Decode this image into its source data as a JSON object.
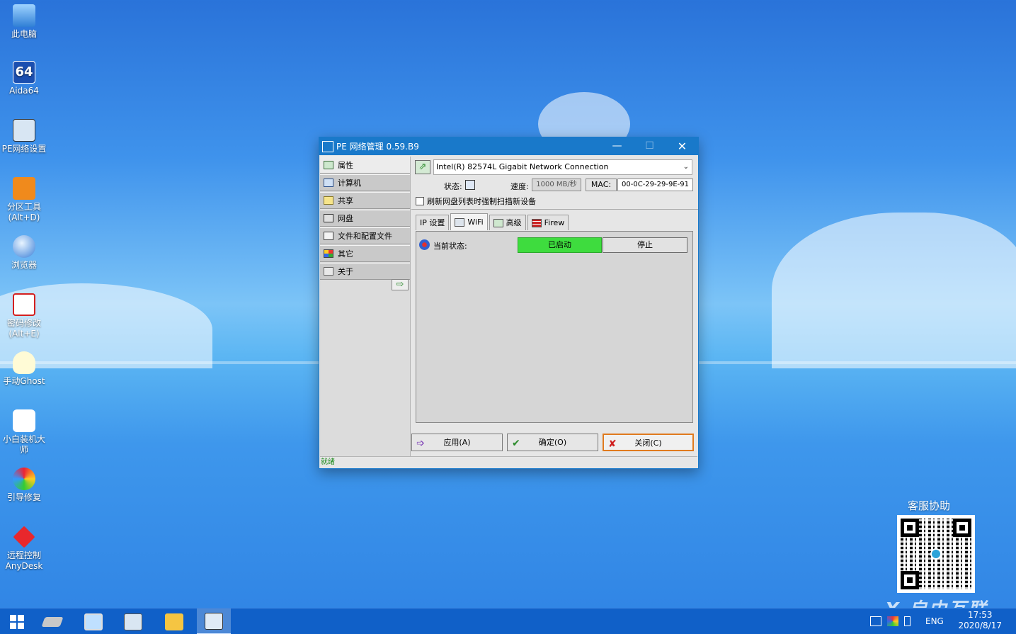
{
  "desktop": {
    "icons": [
      {
        "label": "此电脑"
      },
      {
        "label": "Aida64"
      },
      {
        "label": "PE网络设置"
      },
      {
        "label": "分区工具\n(Alt+D)"
      },
      {
        "label": "浏览器"
      },
      {
        "label": "密码修改\n(Alt+E)"
      },
      {
        "label": "手动Ghost"
      },
      {
        "label": "小白装机大\n师"
      },
      {
        "label": "引导修复"
      },
      {
        "label": "远程控制\nAnyDesk"
      }
    ],
    "qr_title": "客服协助",
    "watermark": "X 自由互联"
  },
  "window": {
    "title": "PE 网络管理 0.59.B9",
    "controls": {
      "minimize": "—",
      "maximize": "☐",
      "close": "✕"
    },
    "sidebar": [
      {
        "label": "属性",
        "active": true
      },
      {
        "label": "计算机"
      },
      {
        "label": "共享"
      },
      {
        "label": "网盘"
      },
      {
        "label": "文件和配置文件"
      },
      {
        "label": "其它"
      },
      {
        "label": "关于"
      }
    ],
    "adapter": "Intel(R) 82574L Gigabit Network Connection",
    "status_label": "状态:",
    "speed_label": "速度:",
    "speed_value": "1000 MB/秒",
    "mac_label": "MAC:",
    "mac_value": "00-0C-29-29-9E-91",
    "refresh_label": "刷新网盘列表时强制扫描新设备",
    "tabs": [
      {
        "label": "IP 设置"
      },
      {
        "label": "WiFi",
        "active": true
      },
      {
        "label": "高级"
      },
      {
        "label": "Firew"
      }
    ],
    "wifi": {
      "current_state_label": "当前状态:",
      "state_value": "已启动",
      "stop_label": "停止"
    },
    "buttons": {
      "apply": "应用(A)",
      "ok": "确定(O)",
      "close": "关闭(C)"
    },
    "statusbar": "就绪"
  },
  "taskbar": {
    "lang": "ENG",
    "time": "17:53",
    "date": "2020/8/17"
  },
  "colors": {
    "titlebar": "#1979ca",
    "state_green": "#3edc3e",
    "taskbar": "#1060c8"
  }
}
